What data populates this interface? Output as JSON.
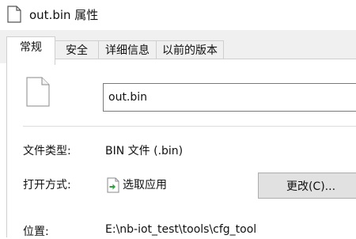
{
  "window": {
    "title": "out.bin 属性",
    "title_icon": "file-icon"
  },
  "tabs": [
    {
      "label": "常规",
      "active": true
    },
    {
      "label": "安全",
      "active": false
    },
    {
      "label": "详细信息",
      "active": false
    },
    {
      "label": "以前的版本",
      "active": false
    }
  ],
  "general": {
    "file_icon": "blank-file-icon",
    "file_name": "out.bin",
    "file_type_label": "文件类型:",
    "file_type_value": "BIN 文件 (.bin)",
    "opens_with_label": "打开方式:",
    "opens_with_icon": "choose-app-icon",
    "opens_with_value": "选取应用",
    "change_button_label": "更改(C)...",
    "location_label": "位置:",
    "location_value": "E:\\nb-iot_test\\tools\\cfg_tool"
  },
  "colors": {
    "tab_strip": "#f0f0f0",
    "button_face": "#e1e1e1",
    "app_icon_arrow": "#2e9e3e"
  }
}
